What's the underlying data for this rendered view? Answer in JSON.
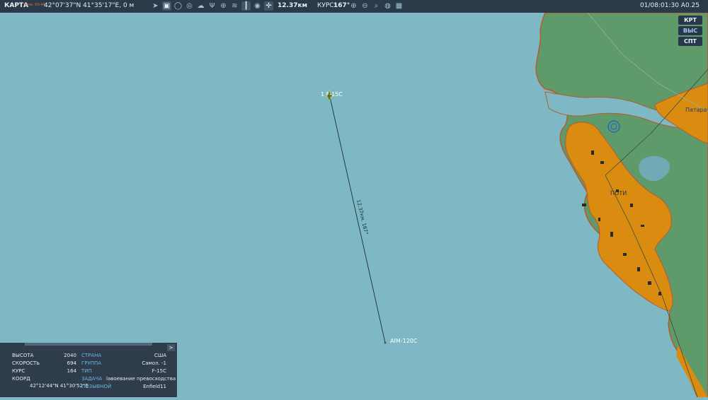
{
  "topbar": {
    "mode_label": "КАРТА",
    "overlay_hint": "Точк. 00:44",
    "coords": "42°07'37\"N 41°35'17\"E, 0 м",
    "distance": "12.37км",
    "course_label": "КУРС:",
    "course_value": "167°",
    "time": "01/08:01:30 A0.25",
    "icons": [
      "send-icon",
      "radar-icon",
      "circle-icon",
      "layers-icon",
      "cloud-icon",
      "fork-icon",
      "target-icon",
      "signal-icon",
      "tower-icon",
      "chat-icon",
      "crosshair-icon",
      "zoom-in-icon",
      "zoom-out-icon",
      "zoom-fit-icon",
      "globe-icon",
      "grid-icon"
    ]
  },
  "map": {
    "buttons": [
      "КРТ",
      "ВЫС",
      "СПТ"
    ],
    "aircraft_label": "1 F-15C",
    "missile_label": "AIM-120C",
    "ruler_label": "12.37км, 167°",
    "city_label": "ПОТИ",
    "town_label": "Патара-Г",
    "colors": {
      "sea": "#7db8c4",
      "land": "#5f9a6a",
      "urban": "#d98c10",
      "coast": "#b85a30"
    }
  },
  "info": {
    "altitude_label": "ВЫСОТА",
    "altitude_value": "2040",
    "speed_label": "СКОРОСТЬ",
    "speed_value": "694",
    "course_label": "КУРС",
    "course_value": "164",
    "coord_label": "КООРД",
    "coord_value": "42°12'44\"N 41°30'52\"E",
    "country_label": "СТРАНА",
    "country_value": "США",
    "group_label": "ГРУППА",
    "group_value": "Самол. -1",
    "type_label": "ТИП",
    "type_value": "F-15C",
    "task_label": "ЗАДАЧА",
    "task_value": "lавоевание превосходства",
    "callsign_label": "ПОЗЫВНОЙ",
    "callsign_value": "Enfield11",
    "toggle": ">"
  }
}
